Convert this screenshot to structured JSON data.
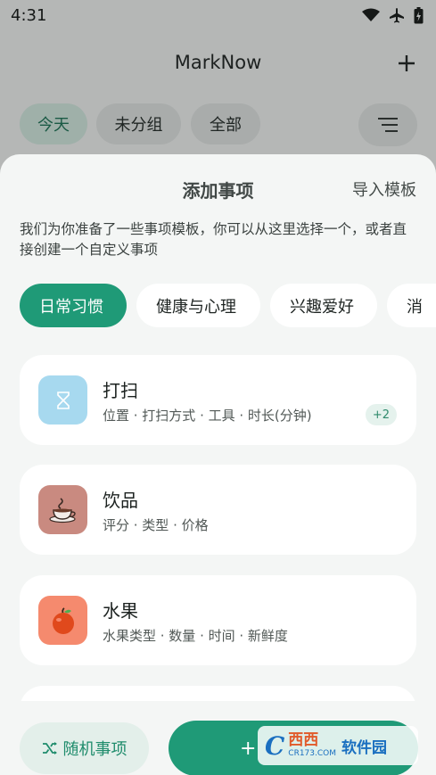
{
  "status": {
    "time": "4:31"
  },
  "app": {
    "title": "MarkNow",
    "filters": [
      {
        "label": "今天",
        "active": true
      },
      {
        "label": "未分组",
        "active": false
      },
      {
        "label": "全部",
        "active": false
      }
    ]
  },
  "sheet": {
    "title": "添加事项",
    "import_label": "导入模板",
    "description": "我们为你准备了一些事项模板，你可以从这里选择一个，或者直接创建一个自定义事项",
    "categories": [
      {
        "label": "日常习惯",
        "active": true
      },
      {
        "label": "健康与心理",
        "active": false
      },
      {
        "label": "兴趣爱好",
        "active": false
      },
      {
        "label": "消",
        "active": false
      }
    ],
    "templates": [
      {
        "title": "打扫",
        "fields": "位置 · 打扫方式 · 工具 · 时长(分钟)",
        "badge": "+2",
        "icon": "hourglass-icon",
        "icon_bg": "#a7d9ef"
      },
      {
        "title": "饮品",
        "fields": "评分 · 类型 · 价格",
        "icon": "coffee-cup-icon",
        "icon_bg": "#c98a80"
      },
      {
        "title": "水果",
        "fields": "水果类型 · 数量 · 时间 · 新鲜度",
        "icon": "apple-icon",
        "icon_bg": "#f58a6e"
      }
    ]
  },
  "actions": {
    "random_label": "随机事项",
    "create_label": "+"
  },
  "watermark": {
    "brand": "西西",
    "cn": "软件园",
    "url": "CR173.COM"
  },
  "colors": {
    "accent": "#1f9a77",
    "accent_light": "#e3efea"
  }
}
